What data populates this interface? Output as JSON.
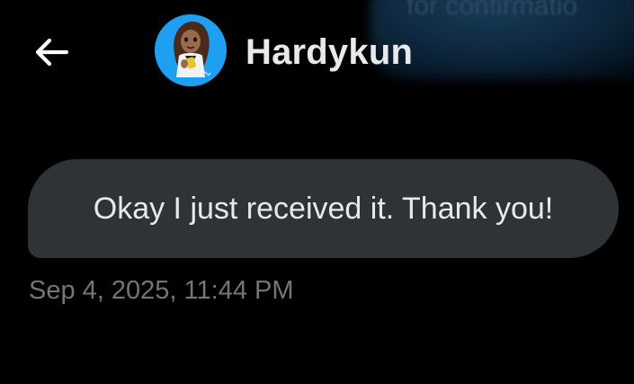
{
  "overlay": {
    "text": "for confirmatio"
  },
  "header": {
    "back_icon": "arrow-left-icon",
    "avatar_icon": "avatar-illustration",
    "contact_name": "Hardykun"
  },
  "conversation": {
    "messages": [
      {
        "text": "Okay I just received it. Thank you!",
        "timestamp": "Sep 4, 2025, 11:44 PM"
      }
    ]
  },
  "colors": {
    "background": "#000000",
    "bubble": "#2f3336",
    "primary_text": "#e7e9ea",
    "secondary_text": "#71767b",
    "avatar_bg": "#1e9ff2"
  }
}
